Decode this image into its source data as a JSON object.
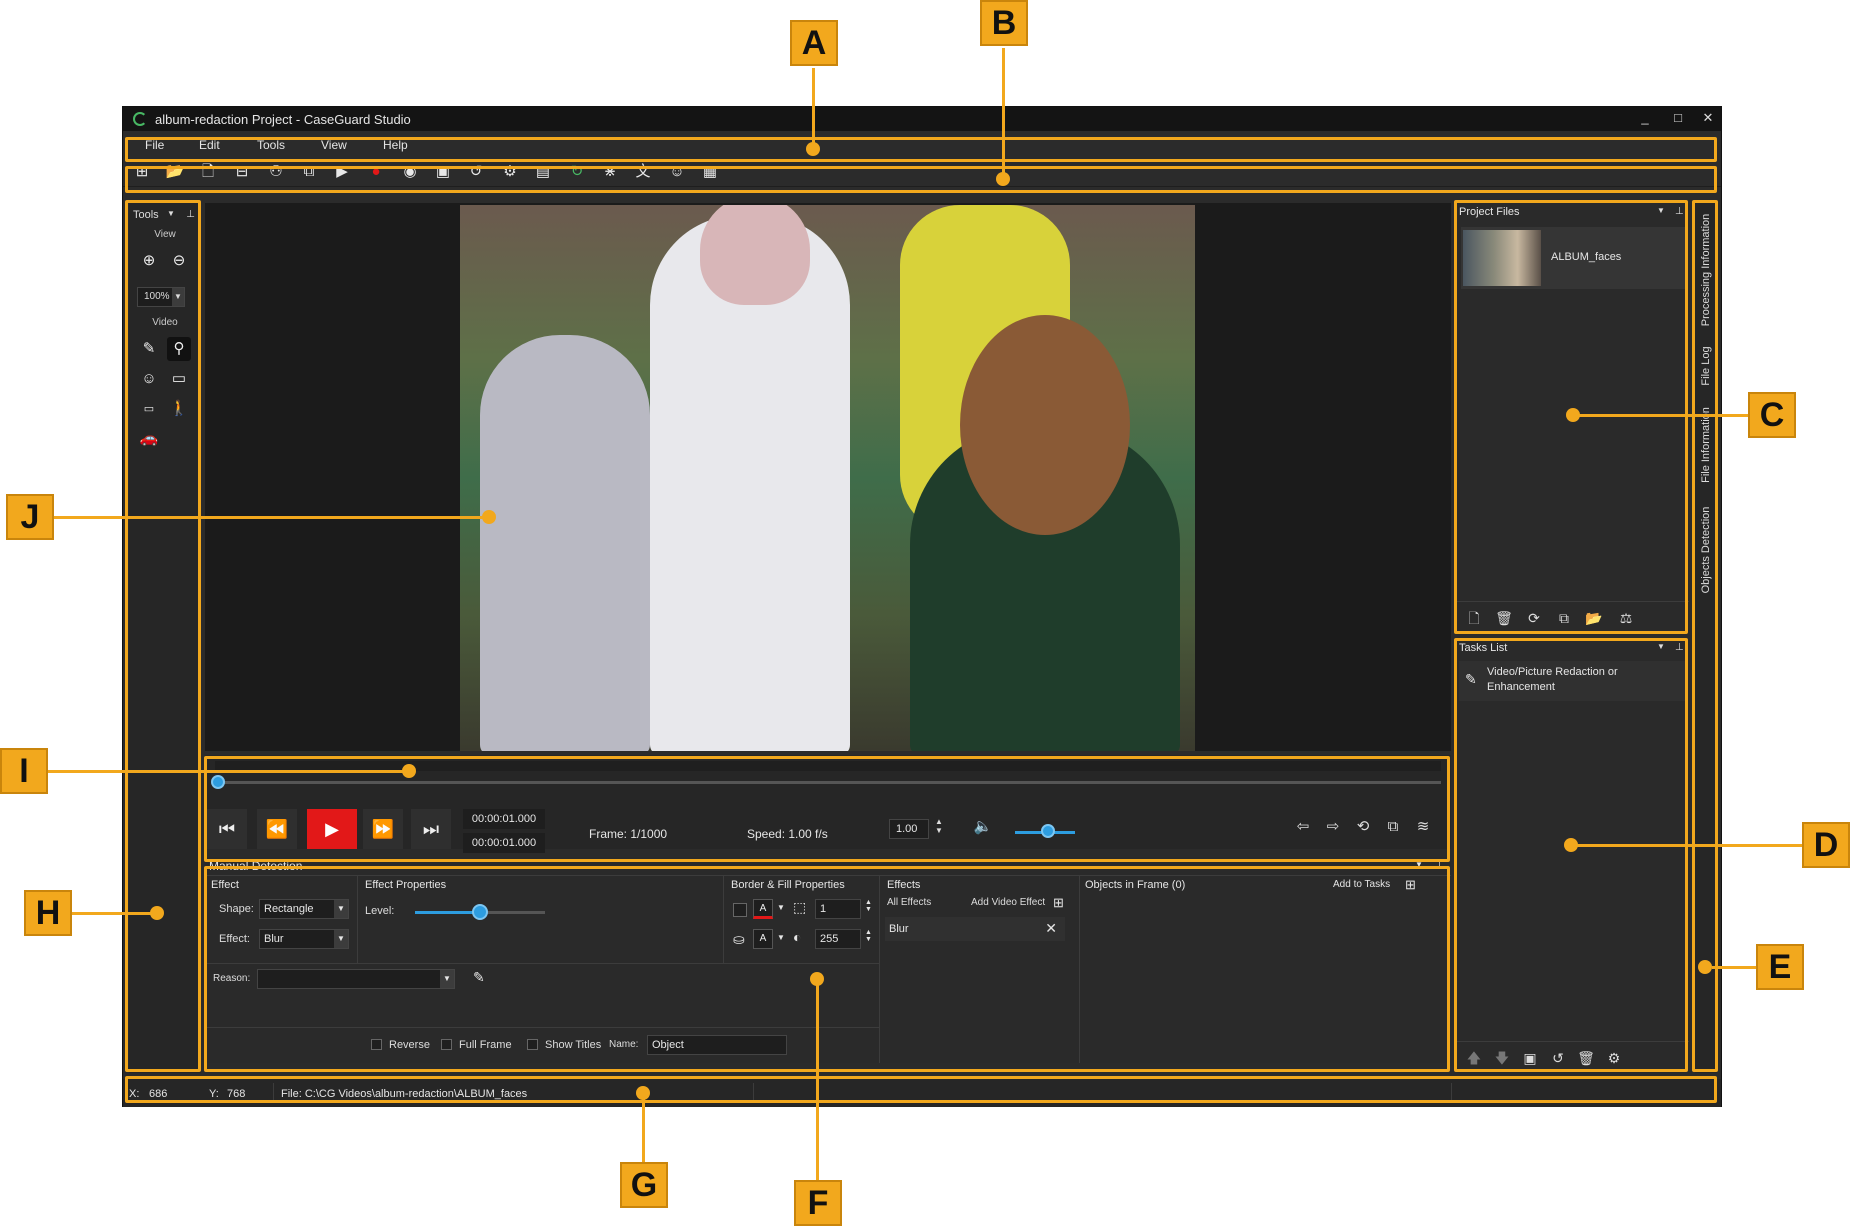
{
  "window": {
    "title": "album-redaction Project - CaseGuard Studio",
    "minimize": "_",
    "maximize": "□",
    "close": "✕"
  },
  "menu": [
    "File",
    "Edit",
    "Tools",
    "View",
    "Help"
  ],
  "tools_panel": {
    "title": "Tools",
    "view_label": "View",
    "zoom": "100%",
    "video_label": "Video"
  },
  "player": {
    "time_current": "00:00:01.000",
    "time_total": "00:00:01.000",
    "frame": "Frame: 1/1000",
    "speed_label": "Speed: 1.00 f/s",
    "speed_value": "1.00",
    "progress": 0.0
  },
  "manual_detection": {
    "title": "Manual Detection",
    "effect_header": "Effect",
    "shape_label": "Shape:",
    "shape_value": "Rectangle",
    "effect_label": "Effect:",
    "effect_value": "Blur",
    "effect_props_header": "Effect Properties",
    "level_label": "Level:",
    "level_value": 0.5,
    "border_header": "Border & Fill Properties",
    "border_width": "1",
    "fill_opacity": "255",
    "effects_header": "Effects",
    "all_effects": "All Effects",
    "add_video_effect": "Add Video Effect",
    "effect_item": "Blur",
    "objects_header": "Objects in Frame (0)",
    "add_to_tasks": "Add to Tasks",
    "reason_label": "Reason:",
    "reverse": "Reverse",
    "full_frame": "Full Frame",
    "show_titles": "Show Titles",
    "name_label": "Name:",
    "name_value": "Object"
  },
  "project_files": {
    "title": "Project Files",
    "file_name": "ALBUM_faces"
  },
  "tasks_list": {
    "title": "Tasks List",
    "item_line1": "Video/Picture Redaction or",
    "item_line2": "Enhancement"
  },
  "side_tabs": [
    "Processing Information",
    "File Log",
    "File Information",
    "Objects Detection"
  ],
  "status": {
    "x_label": "X:",
    "x_value": "686",
    "y_label": "Y:",
    "y_value": "768",
    "file": "File: C:\\CG Videos\\album-redaction\\ALBUM_faces"
  },
  "callouts": [
    "A",
    "B",
    "C",
    "D",
    "E",
    "F",
    "G",
    "H",
    "I",
    "J"
  ],
  "colors": {
    "highlight": "#f2a81d",
    "play": "#e21818",
    "accent": "#2d9de0"
  }
}
